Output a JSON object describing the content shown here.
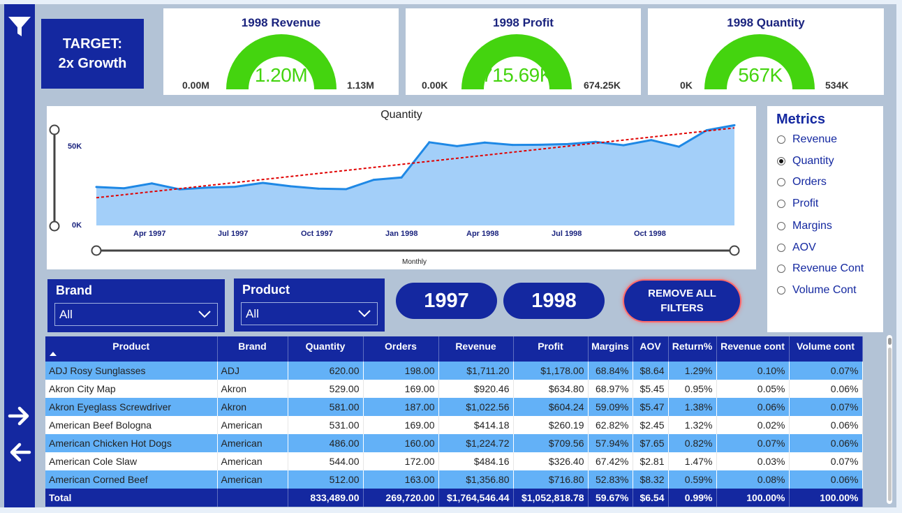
{
  "target": {
    "line1": "TARGET:",
    "line2": "2x Growth"
  },
  "kpis": [
    {
      "title": "1998 Revenue",
      "value": "1.20M",
      "min": "0.00M",
      "max": "1.13M"
    },
    {
      "title": "1998 Profit",
      "value": "715.69K",
      "min": "0.00K",
      "max": "674.25K"
    },
    {
      "title": "1998 Quantity",
      "value": "567K",
      "min": "0K",
      "max": "534K"
    }
  ],
  "chart_data": {
    "type": "area",
    "title": "Quantity",
    "xlabel": "Monthly",
    "ylabel": "",
    "y_ticks": [
      "0K",
      "50K"
    ],
    "x_ticks": [
      "Apr 1997",
      "Jul 1997",
      "Oct 1997",
      "Jan 1998",
      "Apr 1998",
      "Jul 1998",
      "Oct 1998"
    ],
    "ylim": [
      0,
      55000
    ],
    "x": [
      "Jan 1997",
      "Feb 1997",
      "Mar 1997",
      "Apr 1997",
      "May 1997",
      "Jun 1997",
      "Jul 1997",
      "Aug 1997",
      "Sep 1997",
      "Oct 1997",
      "Nov 1997",
      "Dec 1997",
      "Jan 1998",
      "Feb 1998",
      "Mar 1998",
      "Apr 1998",
      "May 1998",
      "Jun 1998",
      "Jul 1998",
      "Aug 1998",
      "Sep 1998",
      "Oct 1998",
      "Nov 1998",
      "Dec 1998"
    ],
    "series": [
      {
        "values": [
          21500,
          20800,
          23500,
          20200,
          21200,
          21600,
          23800,
          21900,
          20600,
          20300,
          25500,
          26800,
          46500,
          44300,
          46300,
          45000,
          45100,
          45500,
          46700,
          44800,
          47700,
          44000,
          53200,
          56000
        ]
      }
    ],
    "trendline": {
      "start": 15500,
      "end": 54500,
      "color": "#e00000"
    },
    "fill_color": "#a3cff9",
    "line_color": "#1e88e5"
  },
  "metrics": {
    "title": "Metrics",
    "options": [
      "Revenue",
      "Quantity",
      "Orders",
      "Profit",
      "Margins",
      "AOV",
      "Revenue Cont",
      "Volume Cont"
    ],
    "selected": "Quantity"
  },
  "slicers": {
    "brand": {
      "title": "Brand",
      "value": "All"
    },
    "product": {
      "title": "Product",
      "value": "All"
    }
  },
  "year_buttons": [
    "1997",
    "1998"
  ],
  "remove_filters": {
    "line1": "REMOVE ALL",
    "line2": "FILTERS"
  },
  "table": {
    "columns": [
      "Product",
      "Brand",
      "Quantity",
      "Orders",
      "Revenue",
      "Profit",
      "Margins",
      "AOV",
      "Return%",
      "Revenue cont",
      "Volume cont"
    ],
    "rows": [
      [
        "ADJ Rosy Sunglasses",
        "ADJ",
        "620.00",
        "198.00",
        "$1,711.20",
        "$1,178.00",
        "68.84%",
        "$8.64",
        "1.29%",
        "0.10%",
        "0.07%"
      ],
      [
        "Akron City Map",
        "Akron",
        "529.00",
        "169.00",
        "$920.46",
        "$634.80",
        "68.97%",
        "$5.45",
        "0.95%",
        "0.05%",
        "0.06%"
      ],
      [
        "Akron Eyeglass Screwdriver",
        "Akron",
        "581.00",
        "187.00",
        "$1,022.56",
        "$604.24",
        "59.09%",
        "$5.47",
        "1.38%",
        "0.06%",
        "0.07%"
      ],
      [
        "American Beef Bologna",
        "American",
        "531.00",
        "169.00",
        "$414.18",
        "$260.19",
        "62.82%",
        "$2.45",
        "1.32%",
        "0.02%",
        "0.06%"
      ],
      [
        "American Chicken Hot Dogs",
        "American",
        "486.00",
        "160.00",
        "$1,224.72",
        "$709.56",
        "57.94%",
        "$7.65",
        "0.82%",
        "0.07%",
        "0.06%"
      ],
      [
        "American Cole Slaw",
        "American",
        "544.00",
        "172.00",
        "$484.16",
        "$326.40",
        "67.42%",
        "$2.81",
        "1.47%",
        "0.03%",
        "0.07%"
      ],
      [
        "American Corned Beef",
        "American",
        "512.00",
        "163.00",
        "$1,356.80",
        "$716.80",
        "52.83%",
        "$8.32",
        "0.59%",
        "0.08%",
        "0.06%"
      ]
    ],
    "total": [
      "Total",
      "",
      "833,489.00",
      "269,720.00",
      "$1,764,546.44",
      "$1,052,818.78",
      "59.67%",
      "$6.54",
      "0.99%",
      "100.00%",
      "100.00%"
    ]
  },
  "colors": {
    "navy": "#1428a0",
    "gauge_green": "#44d40f",
    "row_blue": "#63b1f7"
  },
  "icons": [
    "filter-icon",
    "arrow-right-icon",
    "arrow-left-icon",
    "chevron-down-icon"
  ]
}
